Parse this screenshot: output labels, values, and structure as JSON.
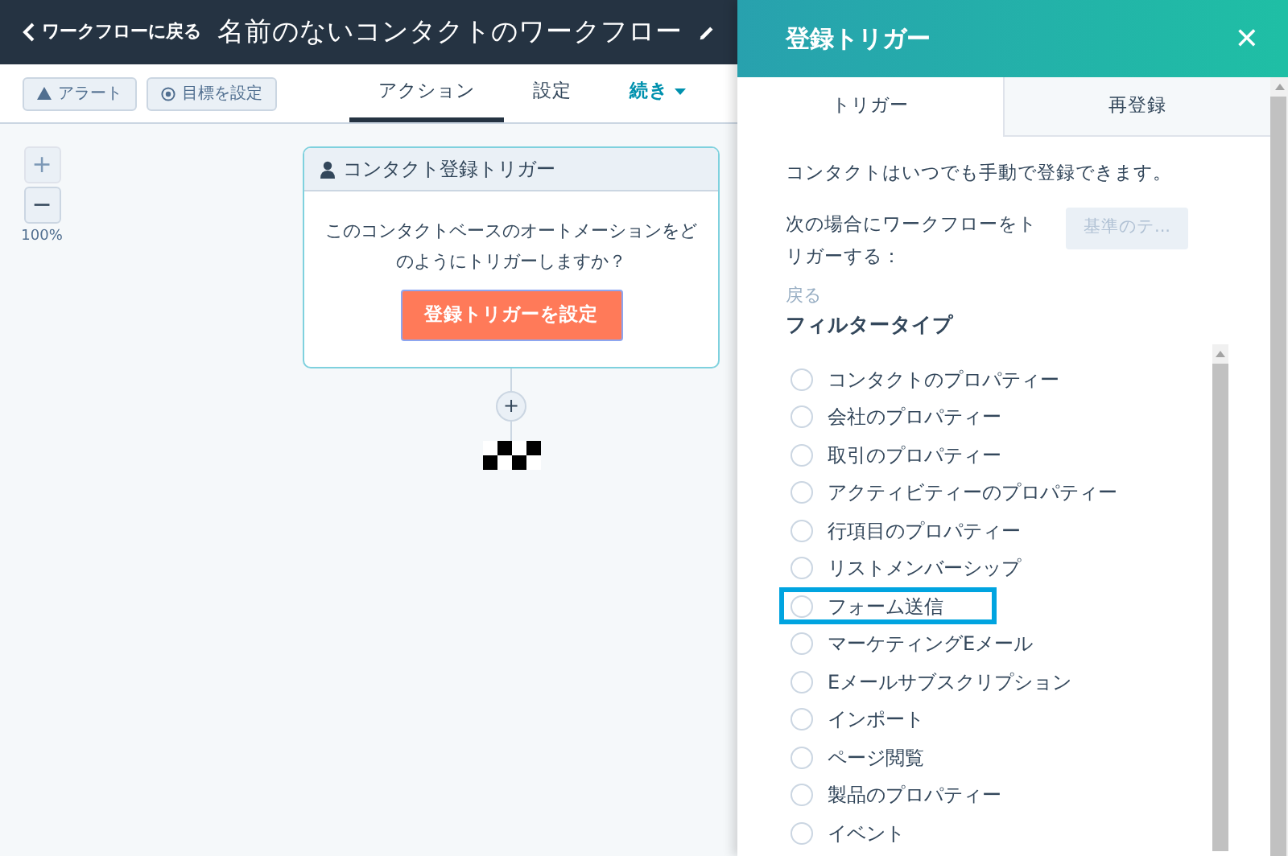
{
  "topbar": {
    "back": "ワークフローに戻る",
    "title": "名前のないコンタクトのワークフロー"
  },
  "toolbar": {
    "buttons": [
      {
        "kind": "alert",
        "label": "アラート"
      },
      {
        "kind": "goal",
        "label": "目標を設定"
      }
    ],
    "tabs": [
      {
        "label": "アクション",
        "selected": true
      },
      {
        "label": "設定",
        "selected": false
      },
      {
        "label": "続き",
        "selected": false,
        "kind": "dropdown"
      }
    ]
  },
  "zoom": {
    "plus": "+",
    "minus": "−",
    "reading": "100%"
  },
  "trigger_card": {
    "title": "コンタクト登録トリガー",
    "text": "このコンタクトベースのオートメーションをどのようにトリガーしますか？",
    "button": "登録トリガーを設定"
  },
  "add_step": "+",
  "panel": {
    "title": "登録トリガー",
    "close": "✕",
    "tabs": [
      {
        "label": "トリガー",
        "selected": true
      },
      {
        "label": "再登録",
        "selected": false
      }
    ],
    "note": "コンタクトはいつでも手動で登録できます。",
    "trigger_label": "次の場合にワークフローをトリガーする：",
    "criteria_button": {
      "label": "基準のテ...",
      "disabled": true
    },
    "back_link": "戻る",
    "filter_heading": "フィルタータイプ",
    "filter_types": [
      {
        "label": "コンタクトのプロパティー",
        "selected": false,
        "highlighted": false
      },
      {
        "label": "会社のプロパティー",
        "selected": false,
        "highlighted": false
      },
      {
        "label": "取引のプロパティー",
        "selected": false,
        "highlighted": false
      },
      {
        "label": "アクティビティーのプロパティー",
        "selected": false,
        "highlighted": false
      },
      {
        "label": "行項目のプロパティー",
        "selected": false,
        "highlighted": false
      },
      {
        "label": "リストメンバーシップ",
        "selected": false,
        "highlighted": false
      },
      {
        "label": "フォーム送信",
        "selected": false,
        "highlighted": true
      },
      {
        "label": "マーケティングEメール",
        "selected": false,
        "highlighted": false
      },
      {
        "label": "Eメールサブスクリプション",
        "selected": false,
        "highlighted": false
      },
      {
        "label": "インポート",
        "selected": false,
        "highlighted": false
      },
      {
        "label": "ページ閲覧",
        "selected": false,
        "highlighted": false
      },
      {
        "label": "製品のプロパティー",
        "selected": false,
        "highlighted": false
      },
      {
        "label": "イベント",
        "selected": false,
        "highlighted": false
      }
    ]
  }
}
